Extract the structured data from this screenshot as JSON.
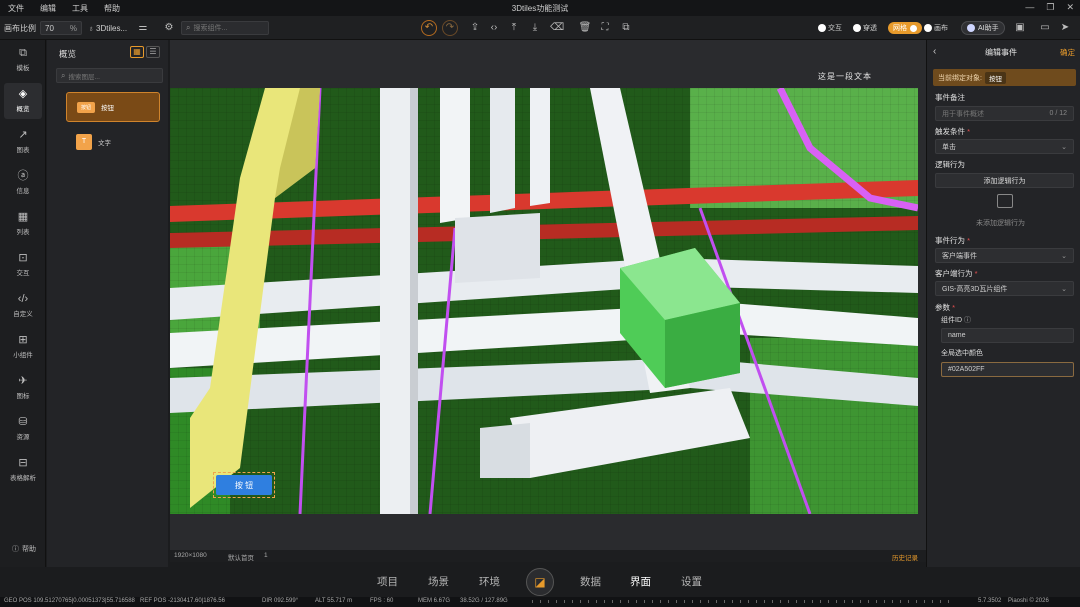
{
  "menubar": {
    "items": [
      "文件",
      "编辑",
      "工具",
      "帮助"
    ],
    "title": "3Dtiles功能测试"
  },
  "toolbar": {
    "canvas_ratio_label": "画布比例",
    "canvas_ratio_value": "70",
    "canvas_ratio_unit": "%",
    "scene_name": "3Dtiles...",
    "search_placeholder": "搜索组件...",
    "toggles": [
      {
        "label": "交互",
        "on": false
      },
      {
        "label": "穿透",
        "on": false
      },
      {
        "label": "网格",
        "on": true
      },
      {
        "label": "画布",
        "on": false
      }
    ],
    "assistant_label": "AI助手"
  },
  "rail": {
    "items": [
      {
        "label": "模板",
        "icon": "template-icon"
      },
      {
        "label": "概览",
        "icon": "layers-icon",
        "active": true
      },
      {
        "label": "图表",
        "icon": "chart-icon"
      },
      {
        "label": "信息",
        "icon": "info-icon"
      },
      {
        "label": "列表",
        "icon": "table-icon"
      },
      {
        "label": "交互",
        "icon": "interact-icon"
      },
      {
        "label": "自定义",
        "icon": "code-icon"
      },
      {
        "label": "小组件",
        "icon": "widget-icon"
      },
      {
        "label": "图标",
        "icon": "plane-icon"
      },
      {
        "label": "资源",
        "icon": "resource-icon"
      },
      {
        "label": "表格解析",
        "icon": "table-parse-icon"
      }
    ],
    "help_label": "帮助"
  },
  "panel": {
    "title": "概览",
    "search_placeholder": "搜索图层...",
    "items": [
      {
        "badge": "按钮",
        "label": "按钮",
        "selected": true
      },
      {
        "badge": "T",
        "label": "文字",
        "selected": false
      }
    ]
  },
  "viewport": {
    "overlay_text": "这是一段文本",
    "button_label": "按 钮"
  },
  "canvas_status": {
    "resolution": "1920×1080",
    "page": "默认首页",
    "layers": "1",
    "history": "历史记录"
  },
  "rpanel": {
    "title": "编辑事件",
    "confirm": "确定",
    "bind_target_label": "当前绑定对象:",
    "bind_target_value": "按钮",
    "remark_label": "事件备注",
    "remark_placeholder": "用于事件概述",
    "remark_count": "0 / 12",
    "trigger_label": "触发条件",
    "trigger_value": "单击",
    "logic_label": "逻辑行为",
    "add_logic": "添加逻辑行为",
    "empty_logic": "未添加逻辑行为",
    "event_action_label": "事件行为",
    "event_action_value": "客户端事件",
    "client_action_label": "客户端行为",
    "client_action_value": "GIS-高亮3D瓦片组件",
    "params_label": "参数",
    "component_id_label": "组件ID",
    "component_id_value": "name",
    "highlight_color_label": "全局选中颜色",
    "highlight_color_value": "#02A502FF"
  },
  "bottomnav": {
    "left": [
      "项目",
      "场景",
      "环境"
    ],
    "right": [
      "数据",
      "界面",
      "设置"
    ],
    "active": "界面"
  },
  "statusbar": {
    "geo_pos": "GEO POS   109.51270765|0.00051373|55.716588",
    "ref_pos": "REF POS  -2130417.60|1876.56",
    "dir": "DIR   092.599°",
    "alt": "ALT   55.717 m",
    "fps": "FPS : 60",
    "mem": "MEM   6.67G",
    "mem2": "38.52G / 127.89G",
    "scale": "5.7.3502",
    "copyright": "Piaoshi © 2026"
  },
  "colors": {
    "accent": "#e79a2b",
    "viewport_green": "#2f8a26",
    "pipe_red": "#d9392e",
    "pipe_purple": "#c14ff0",
    "duct_yellow": "#e9e67a"
  }
}
